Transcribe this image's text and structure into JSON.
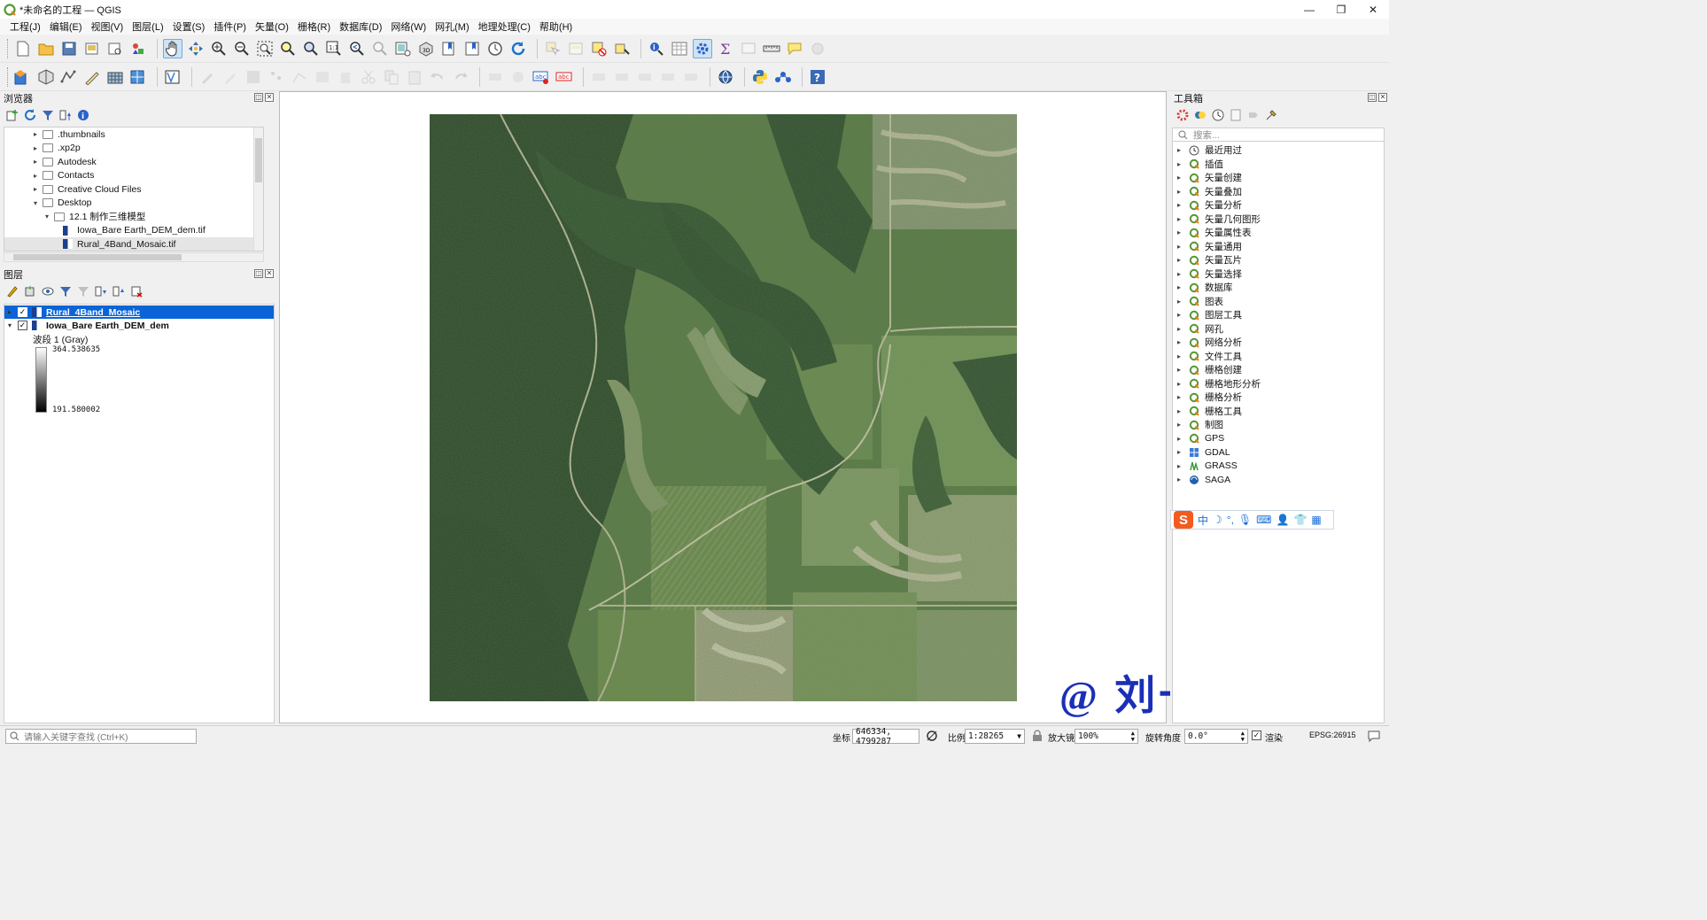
{
  "window": {
    "title": "*未命名的工程 — QGIS"
  },
  "menu": [
    "工程(J)",
    "编辑(E)",
    "视图(V)",
    "图层(L)",
    "设置(S)",
    "插件(P)",
    "矢量(O)",
    "栅格(R)",
    "数据库(D)",
    "网络(W)",
    "网孔(M)",
    "地理处理(C)",
    "帮助(H)"
  ],
  "browser": {
    "title": "浏览器",
    "items": [
      {
        "label": ".thumbnails",
        "level": 1,
        "kind": "folder",
        "arrow": "▸"
      },
      {
        "label": ".xp2p",
        "level": 1,
        "kind": "folder",
        "arrow": "▸"
      },
      {
        "label": "Autodesk",
        "level": 1,
        "kind": "folder",
        "arrow": "▸"
      },
      {
        "label": "Contacts",
        "level": 1,
        "kind": "folder",
        "arrow": "▸"
      },
      {
        "label": "Creative Cloud Files",
        "level": 1,
        "kind": "folder",
        "arrow": "▸"
      },
      {
        "label": "Desktop",
        "level": 1,
        "kind": "folder",
        "arrow": "▾"
      },
      {
        "label": "12.1 制作三维模型",
        "level": 2,
        "kind": "folder",
        "arrow": "▾"
      },
      {
        "label": "Iowa_Bare Earth_DEM_dem.tif",
        "level": 3,
        "kind": "raster",
        "arrow": ""
      },
      {
        "label": "Rural_4Band_Mosaic.tif",
        "level": 3,
        "kind": "raster",
        "arrow": "",
        "selected": true
      }
    ]
  },
  "layers": {
    "title": "图层",
    "items": [
      {
        "label": "Rural_4Band_Mosaic",
        "checked": true,
        "selected": true
      },
      {
        "label": "Iowa_Bare Earth_DEM_dem",
        "checked": true,
        "selected": false
      }
    ],
    "legend": {
      "band": "波段 1 (Gray)",
      "max": "364.538635",
      "min": "191.580002"
    }
  },
  "toolbox": {
    "title": "工具箱",
    "search_placeholder": "搜索...",
    "items": [
      "最近用过",
      "插值",
      "矢量创建",
      "矢量叠加",
      "矢量分析",
      "矢量几何图形",
      "矢量属性表",
      "矢量通用",
      "矢量瓦片",
      "矢量选择",
      "数据库",
      "图表",
      "图层工具",
      "网孔",
      "网络分析",
      "文件工具",
      "栅格创建",
      "栅格地形分析",
      "栅格分析",
      "栅格工具",
      "制图",
      "GPS",
      "GDAL",
      "GRASS",
      "SAGA"
    ]
  },
  "watermark": "@ 刘一哥GIS",
  "statusbar": {
    "locator_placeholder": "请输入关键字查找 (Ctrl+K)",
    "coord_label": "坐标",
    "coord_value": "646334, 4799287",
    "scale_label": "比例",
    "scale_value": "1:28265",
    "magnifier_label": "放大镜",
    "magnifier_value": "100%",
    "rotation_label": "旋转角度",
    "rotation_value": "0.0°",
    "render_label": "渲染",
    "epsg": "EPSG:26915"
  },
  "colors": {
    "selection": "#0a64d8",
    "watermark": "#1a2fb8",
    "qgis_green": "#589632"
  }
}
